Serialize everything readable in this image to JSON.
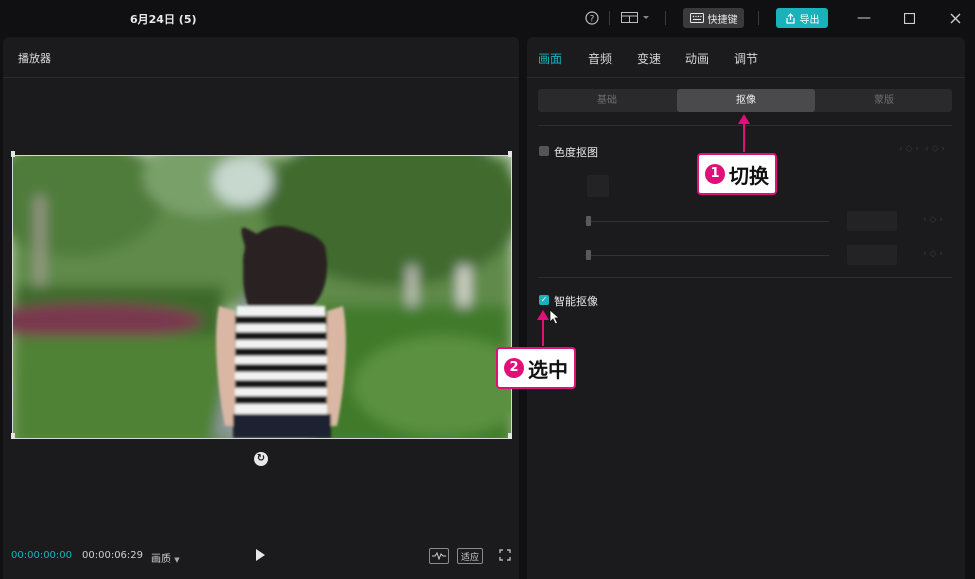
{
  "titlebar": {
    "title": "6月24日 (5)",
    "shortcut_label": "快捷键",
    "export_label": "导出",
    "help_icon": "help-circle-icon",
    "layout_icon": "layout-icon"
  },
  "player": {
    "title": "播放器",
    "current_time": "00:00:00:00",
    "total_time": "00:00:06:29",
    "quality_label": "画质",
    "ratio_label": "适应"
  },
  "panel": {
    "tabs": [
      "画面",
      "音频",
      "变速",
      "动画",
      "调节"
    ],
    "active_tab": "画面",
    "segments": [
      "基础",
      "抠像",
      "蒙版"
    ],
    "active_segment": "抠像",
    "chroma_key_label": "色度抠图",
    "chroma_key_checked": false,
    "smart_cutout_label": "智能抠像",
    "smart_cutout_checked": true
  },
  "annotations": {
    "step1_number": "1",
    "step1_text": "切换",
    "step2_number": "2",
    "step2_text": "选中"
  },
  "colors": {
    "accent": "#19b1ba",
    "annotation": "#e0107a"
  }
}
